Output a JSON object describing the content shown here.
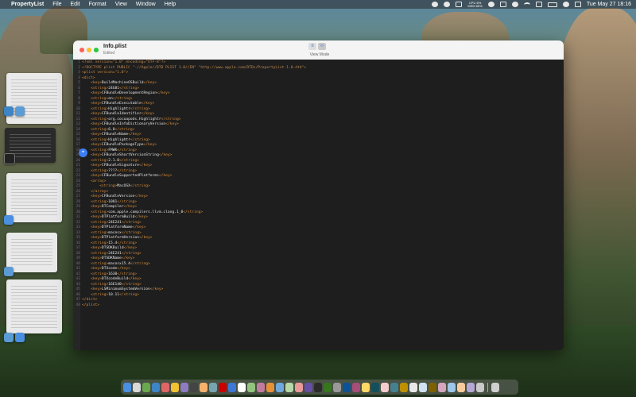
{
  "menubar": {
    "app_name": "PropertyList",
    "menus": [
      "File",
      "Edit",
      "Format",
      "View",
      "Window",
      "Help"
    ],
    "perf_top": "CPU 6%",
    "perf_bottom": "MEM 65%",
    "date_time": "Tue May 27  18:16"
  },
  "window": {
    "title": "Info.plist",
    "subtitle": "Edited",
    "view_mode_label": "View Mode",
    "code_lines": [
      [
        {
          "t": "decl",
          "v": "<?xml version=\"1.0\" encoding=\"UTF-8\"?>"
        }
      ],
      [
        {
          "t": "decl",
          "v": "<!DOCTYPE plist PUBLIC \"-//Apple//DTD PLIST 1.0//EN\" \"http://www.apple.com/DTDs/PropertyList-1.0.dtd\">"
        }
      ],
      [
        {
          "t": "tag",
          "v": "<plist version=\"1.0\">"
        }
      ],
      [
        {
          "t": "tag",
          "v": "<dict>"
        }
      ],
      [
        {
          "t": "text",
          "v": "    "
        },
        {
          "t": "tag",
          "v": "<key>"
        },
        {
          "t": "text",
          "v": "BuildMachineOSBuild"
        },
        {
          "t": "tag",
          "v": "</key>"
        }
      ],
      [
        {
          "t": "text",
          "v": "    "
        },
        {
          "t": "tag",
          "v": "<string>"
        },
        {
          "t": "text",
          "v": "24G81"
        },
        {
          "t": "tag",
          "v": "</string>"
        }
      ],
      [
        {
          "t": "text",
          "v": "    "
        },
        {
          "t": "tag",
          "v": "<key>"
        },
        {
          "t": "text",
          "v": "CFBundleDevelopmentRegion"
        },
        {
          "t": "tag",
          "v": "</key>"
        }
      ],
      [
        {
          "t": "text",
          "v": "    "
        },
        {
          "t": "tag",
          "v": "<string>"
        },
        {
          "t": "text",
          "v": "en"
        },
        {
          "t": "tag",
          "v": "</string>"
        }
      ],
      [
        {
          "t": "text",
          "v": "    "
        },
        {
          "t": "tag",
          "v": "<key>"
        },
        {
          "t": "text",
          "v": "CFBundleExecutable"
        },
        {
          "t": "tag",
          "v": "</key>"
        }
      ],
      [
        {
          "t": "text",
          "v": "    "
        },
        {
          "t": "tag",
          "v": "<string>"
        },
        {
          "t": "text",
          "v": "Highlightr"
        },
        {
          "t": "tag",
          "v": "</string>"
        }
      ],
      [
        {
          "t": "text",
          "v": "    "
        },
        {
          "t": "tag",
          "v": "<key>"
        },
        {
          "t": "text",
          "v": "CFBundleIdentifier"
        },
        {
          "t": "tag",
          "v": "</key>"
        }
      ],
      [
        {
          "t": "text",
          "v": "    "
        },
        {
          "t": "tag",
          "v": "<string>"
        },
        {
          "t": "text",
          "v": "org.cocoapods.Highlightr"
        },
        {
          "t": "tag",
          "v": "</string>"
        }
      ],
      [
        {
          "t": "text",
          "v": "    "
        },
        {
          "t": "tag",
          "v": "<key>"
        },
        {
          "t": "text",
          "v": "CFBundleInfoDictionaryVersion"
        },
        {
          "t": "tag",
          "v": "</key>"
        }
      ],
      [
        {
          "t": "text",
          "v": "    "
        },
        {
          "t": "tag",
          "v": "<string>"
        },
        {
          "t": "text",
          "v": "6.0"
        },
        {
          "t": "tag",
          "v": "</string>"
        }
      ],
      [
        {
          "t": "text",
          "v": "    "
        },
        {
          "t": "tag",
          "v": "<key>"
        },
        {
          "t": "text",
          "v": "CFBundleName"
        },
        {
          "t": "tag",
          "v": "</key>"
        }
      ],
      [
        {
          "t": "text",
          "v": "    "
        },
        {
          "t": "tag",
          "v": "<string>"
        },
        {
          "t": "text",
          "v": "Highlightr"
        },
        {
          "t": "tag",
          "v": "</string>"
        }
      ],
      [
        {
          "t": "text",
          "v": "    "
        },
        {
          "t": "tag",
          "v": "<key>"
        },
        {
          "t": "text",
          "v": "CFBundlePackageType"
        },
        {
          "t": "tag",
          "v": "</key>"
        }
      ],
      [
        {
          "t": "text",
          "v": "    "
        },
        {
          "t": "tag",
          "v": "<string>"
        },
        {
          "t": "text",
          "v": "FMWK"
        },
        {
          "t": "tag",
          "v": "</string>"
        }
      ],
      [
        {
          "t": "text",
          "v": "    "
        },
        {
          "t": "tag",
          "v": "<key>"
        },
        {
          "t": "text",
          "v": "CFBundleShortVersionString"
        },
        {
          "t": "tag",
          "v": "</key>"
        }
      ],
      [
        {
          "t": "text",
          "v": "    "
        },
        {
          "t": "tag",
          "v": "<string>"
        },
        {
          "t": "text",
          "v": "2.1.0"
        },
        {
          "t": "tag",
          "v": "</string>"
        }
      ],
      [
        {
          "t": "text",
          "v": "    "
        },
        {
          "t": "tag",
          "v": "<key>"
        },
        {
          "t": "text",
          "v": "CFBundleSignature"
        },
        {
          "t": "tag",
          "v": "</key>"
        }
      ],
      [
        {
          "t": "text",
          "v": "    "
        },
        {
          "t": "tag",
          "v": "<string>"
        },
        {
          "t": "text",
          "v": "????"
        },
        {
          "t": "tag",
          "v": "</string>"
        }
      ],
      [
        {
          "t": "text",
          "v": "    "
        },
        {
          "t": "tag",
          "v": "<key>"
        },
        {
          "t": "text",
          "v": "CFBundleSupportedPlatforms"
        },
        {
          "t": "tag",
          "v": "</key>"
        }
      ],
      [
        {
          "t": "text",
          "v": "    "
        },
        {
          "t": "tag",
          "v": "<array>"
        }
      ],
      [
        {
          "t": "text",
          "v": "        "
        },
        {
          "t": "tag",
          "v": "<string>"
        },
        {
          "t": "text",
          "v": "MacOSX"
        },
        {
          "t": "tag",
          "v": "</string>"
        }
      ],
      [
        {
          "t": "text",
          "v": "    "
        },
        {
          "t": "tag",
          "v": "</array>"
        }
      ],
      [
        {
          "t": "text",
          "v": "    "
        },
        {
          "t": "tag",
          "v": "<key>"
        },
        {
          "t": "text",
          "v": "CFBundleVersion"
        },
        {
          "t": "tag",
          "v": "</key>"
        }
      ],
      [
        {
          "t": "text",
          "v": "    "
        },
        {
          "t": "tag",
          "v": "<string>"
        },
        {
          "t": "text",
          "v": "1001"
        },
        {
          "t": "tag",
          "v": "</string>"
        }
      ],
      [
        {
          "t": "text",
          "v": "    "
        },
        {
          "t": "tag",
          "v": "<key>"
        },
        {
          "t": "text",
          "v": "DTCompiler"
        },
        {
          "t": "tag",
          "v": "</key>"
        }
      ],
      [
        {
          "t": "text",
          "v": "    "
        },
        {
          "t": "tag",
          "v": "<string>"
        },
        {
          "t": "text",
          "v": "com.apple.compilers.llvm.clang.1_0"
        },
        {
          "t": "tag",
          "v": "</string>"
        }
      ],
      [
        {
          "t": "text",
          "v": "    "
        },
        {
          "t": "tag",
          "v": "<key>"
        },
        {
          "t": "text",
          "v": "DTPlatformBuild"
        },
        {
          "t": "tag",
          "v": "</key>"
        }
      ],
      [
        {
          "t": "text",
          "v": "    "
        },
        {
          "t": "tag",
          "v": "<string>"
        },
        {
          "t": "text",
          "v": "24E241"
        },
        {
          "t": "tag",
          "v": "</string>"
        }
      ],
      [
        {
          "t": "text",
          "v": "    "
        },
        {
          "t": "tag",
          "v": "<key>"
        },
        {
          "t": "text",
          "v": "DTPlatformName"
        },
        {
          "t": "tag",
          "v": "</key>"
        }
      ],
      [
        {
          "t": "text",
          "v": "    "
        },
        {
          "t": "tag",
          "v": "<string>"
        },
        {
          "t": "text",
          "v": "macosx"
        },
        {
          "t": "tag",
          "v": "</string>"
        }
      ],
      [
        {
          "t": "text",
          "v": "    "
        },
        {
          "t": "tag",
          "v": "<key>"
        },
        {
          "t": "text",
          "v": "DTPlatformVersion"
        },
        {
          "t": "tag",
          "v": "</key>"
        }
      ],
      [
        {
          "t": "text",
          "v": "    "
        },
        {
          "t": "tag",
          "v": "<string>"
        },
        {
          "t": "text",
          "v": "15.4"
        },
        {
          "t": "tag",
          "v": "</string>"
        }
      ],
      [
        {
          "t": "text",
          "v": "    "
        },
        {
          "t": "tag",
          "v": "<key>"
        },
        {
          "t": "text",
          "v": "DTSDKBuild"
        },
        {
          "t": "tag",
          "v": "</key>"
        }
      ],
      [
        {
          "t": "text",
          "v": "    "
        },
        {
          "t": "tag",
          "v": "<string>"
        },
        {
          "t": "text",
          "v": "24E241"
        },
        {
          "t": "tag",
          "v": "</string>"
        }
      ],
      [
        {
          "t": "text",
          "v": "    "
        },
        {
          "t": "tag",
          "v": "<key>"
        },
        {
          "t": "text",
          "v": "DTSDKName"
        },
        {
          "t": "tag",
          "v": "</key>"
        }
      ],
      [
        {
          "t": "text",
          "v": "    "
        },
        {
          "t": "tag",
          "v": "<string>"
        },
        {
          "t": "text",
          "v": "macosx15.4"
        },
        {
          "t": "tag",
          "v": "</string>"
        }
      ],
      [
        {
          "t": "text",
          "v": "    "
        },
        {
          "t": "tag",
          "v": "<key>"
        },
        {
          "t": "text",
          "v": "DTXcode"
        },
        {
          "t": "tag",
          "v": "</key>"
        }
      ],
      [
        {
          "t": "text",
          "v": "    "
        },
        {
          "t": "tag",
          "v": "<string>"
        },
        {
          "t": "text",
          "v": "1630"
        },
        {
          "t": "tag",
          "v": "</string>"
        }
      ],
      [
        {
          "t": "text",
          "v": "    "
        },
        {
          "t": "tag",
          "v": "<key>"
        },
        {
          "t": "text",
          "v": "DTXcodeBuild"
        },
        {
          "t": "tag",
          "v": "</key>"
        }
      ],
      [
        {
          "t": "text",
          "v": "    "
        },
        {
          "t": "tag",
          "v": "<string>"
        },
        {
          "t": "text",
          "v": "16E140"
        },
        {
          "t": "tag",
          "v": "</string>"
        }
      ],
      [
        {
          "t": "text",
          "v": "    "
        },
        {
          "t": "tag",
          "v": "<key>"
        },
        {
          "t": "text",
          "v": "LSMinimumSystemVersion"
        },
        {
          "t": "tag",
          "v": "</key>"
        }
      ],
      [
        {
          "t": "text",
          "v": "    "
        },
        {
          "t": "tag",
          "v": "<string>"
        },
        {
          "t": "text",
          "v": "10.11"
        },
        {
          "t": "tag",
          "v": "</string>"
        }
      ],
      [
        {
          "t": "tag",
          "v": "</dict>"
        }
      ],
      [
        {
          "t": "tag",
          "v": "</plist>"
        }
      ]
    ]
  },
  "colors": {
    "xml_tag": "#d48c3a",
    "xml_text": "#e4e4e4",
    "editor_bg": "#1e1e1e",
    "accent": "#3b7ef5"
  },
  "dock": {
    "icon_colors": [
      "#4a90e2",
      "#d9d9d9",
      "#6aa84f",
      "#3d85c6",
      "#e06666",
      "#f1c232",
      "#8e7cc3",
      "#444444",
      "#f6b26b",
      "#76a5af",
      "#cc0000",
      "#3c78d8",
      "#ffffff",
      "#93c47d",
      "#c27ba0",
      "#e69138",
      "#6fa8dc",
      "#b6d7a8",
      "#ea9999",
      "#674ea7",
      "#2b2b2b",
      "#38761d",
      "#999999",
      "#0b5394",
      "#a64d79",
      "#ffd966",
      "#134f5c",
      "#f4cccc",
      "#45818e",
      "#bf9000",
      "#e8e8e8",
      "#cfe2f3",
      "#7f6000",
      "#d5a6bd",
      "#9fc5e8",
      "#f9cb9c",
      "#b4a7d6",
      "#c9c9c9"
    ],
    "trash_color": "#cfcfcf"
  }
}
